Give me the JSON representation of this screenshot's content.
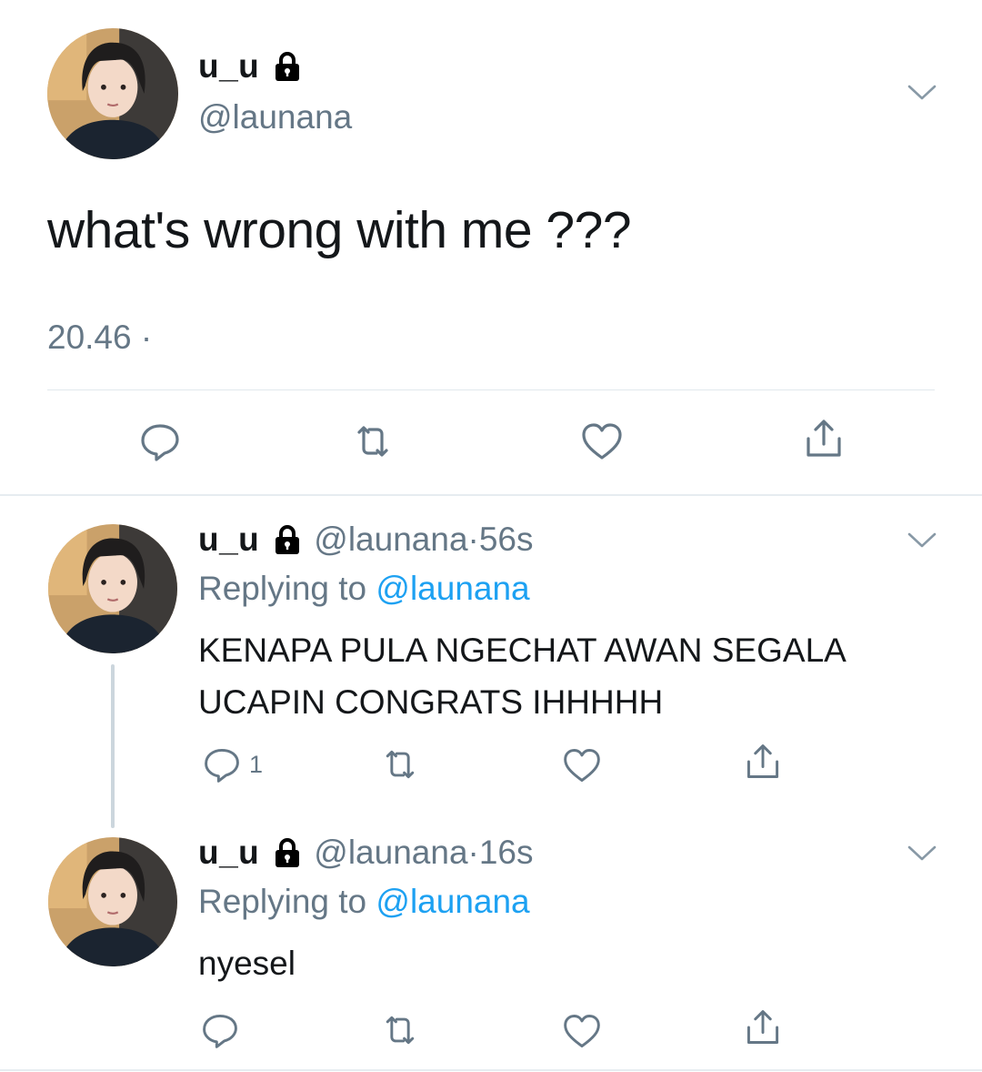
{
  "main_tweet": {
    "display_name": "u_u",
    "handle": "@launana",
    "text": "what's wrong with me ???",
    "time": "20.46 ·"
  },
  "replies": [
    {
      "display_name": "u_u",
      "handle": "@launana",
      "age": "56s",
      "replying_prefix": "Replying to",
      "replying_to": "@launana",
      "text": "KENAPA PULA NGECHAT AWAN SEGALA UCAPIN CONGRATS IHHHHH",
      "reply_count": "1"
    },
    {
      "display_name": "u_u",
      "handle": "@launana",
      "age": "16s",
      "replying_prefix": "Replying to",
      "replying_to": "@launana",
      "text": "nyesel",
      "reply_count": ""
    }
  ],
  "icons": {
    "lock": "lock-icon",
    "more": "chevron-down-icon",
    "reply": "reply-icon",
    "retweet": "retweet-icon",
    "like": "heart-icon",
    "share": "share-icon"
  },
  "colors": {
    "text": "#14171a",
    "muted": "#657786",
    "link": "#1da1f2",
    "divider": "#e1e8ed",
    "icon": "#657786"
  }
}
